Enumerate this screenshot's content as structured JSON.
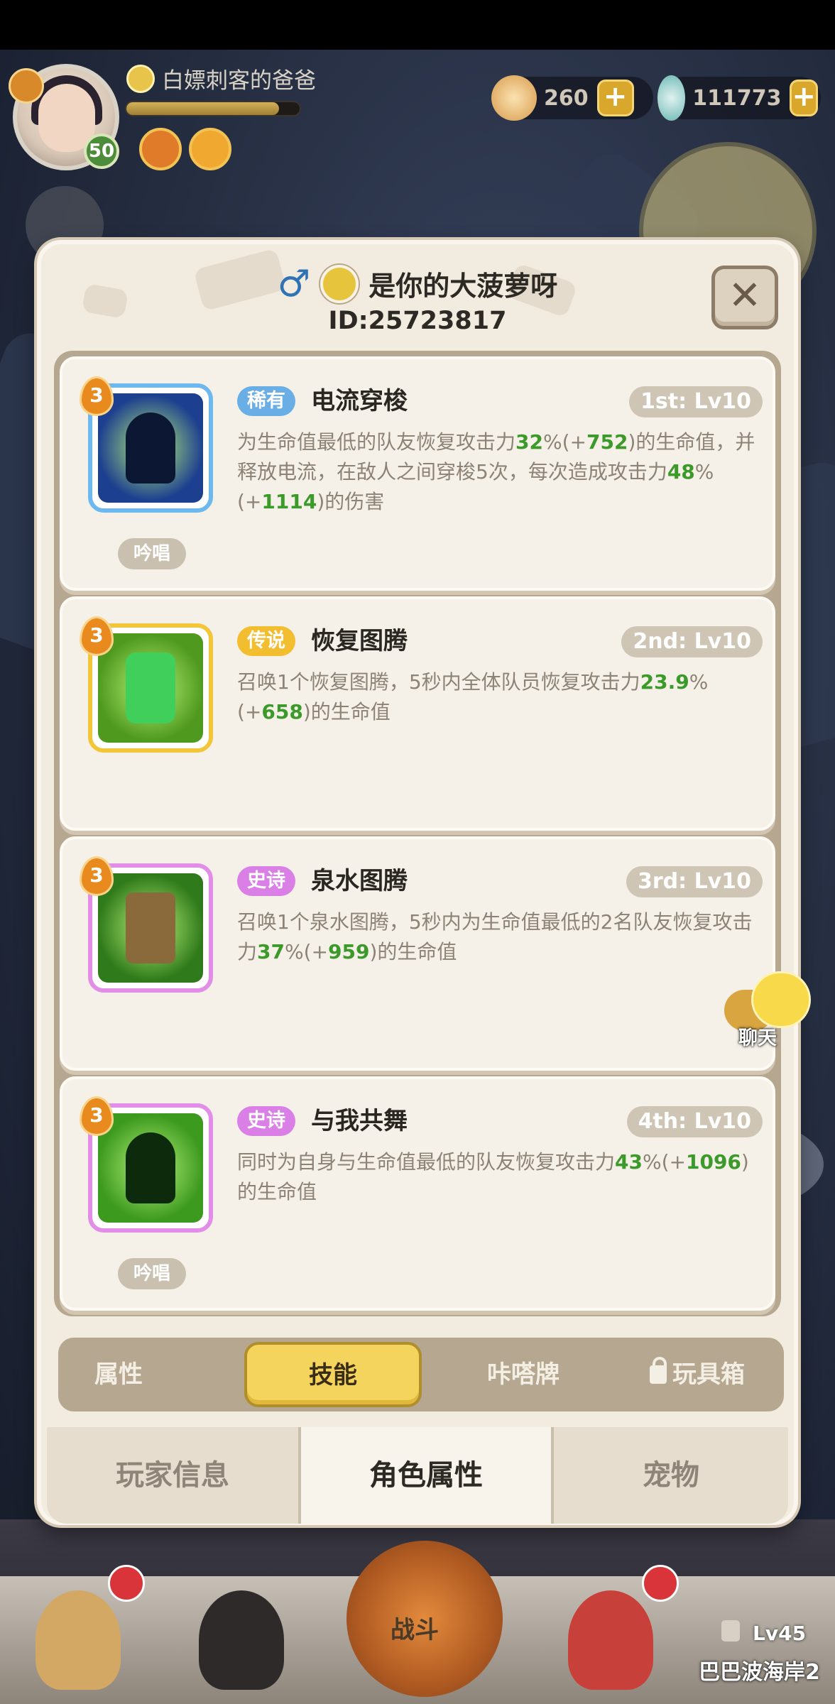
{
  "hud": {
    "player_name": "白嫖刺客的爸爸",
    "level": "50",
    "xp_fraction": 0.88,
    "currencies": [
      {
        "icon": "shell-star-icon",
        "value": "260"
      },
      {
        "icon": "pearl-icon",
        "value": "111773"
      }
    ],
    "plus_label": "+"
  },
  "modal": {
    "gender_icon": "♂",
    "player_name": "是你的大菠萝呀",
    "player_id": "ID:25723817",
    "close_label": "✕",
    "skills": [
      {
        "level_badge": "3",
        "rarity": "稀有",
        "rarity_color": "#6aaee6",
        "name": "电流穿梭",
        "slot": "1st: Lv10",
        "desc_parts": [
          "为生命值最低的队友恢复攻击力",
          "32",
          "%(+",
          "752",
          ")的生命值，并释放电流，在敌人之间穿梭5次，每次造成攻击力",
          "48",
          "%(+",
          "1114",
          ")的伤害"
        ],
        "chant": "吟唱",
        "icon_border": "#6cb8ef",
        "icon_bg": "#1c3f8f"
      },
      {
        "level_badge": "3",
        "rarity": "传说",
        "rarity_color": "#f2bd2e",
        "name": "恢复图腾",
        "slot": "2nd: Lv10",
        "desc_parts": [
          "召唤1个恢复图腾，5秒内全体队员恢复攻击力",
          "23.9",
          "%(+",
          "658",
          ")的生命值"
        ],
        "chant": "",
        "icon_border": "#f3c63a",
        "icon_bg": "#4f9a1e"
      },
      {
        "level_badge": "3",
        "rarity": "史诗",
        "rarity_color": "#d97fe6",
        "name": "泉水图腾",
        "slot": "3rd: Lv10",
        "desc_parts": [
          "召唤1个泉水图腾，5秒内为生命值最低的2名队友恢复攻击力",
          "37",
          "%(+",
          "959",
          ")的生命值"
        ],
        "chant": "",
        "icon_border": "#e28ee8",
        "icon_bg": "#2f7a1a"
      },
      {
        "level_badge": "3",
        "rarity": "史诗",
        "rarity_color": "#d97fe6",
        "name": "与我共舞",
        "slot": "4th: Lv10",
        "desc_parts": [
          "同时为自身与生命值最低的队友恢复攻击力",
          "43",
          "%(+",
          "1096",
          ")的生命值"
        ],
        "chant": "吟唱",
        "icon_border": "#e28ee8",
        "icon_bg": "#3c9a1e"
      }
    ],
    "subtabs": [
      "属性",
      "技能",
      "咔嗒牌",
      "玩具箱"
    ],
    "active_subtab": "技能",
    "maintabs": [
      "玩家信息",
      "角色属性",
      "宠物"
    ],
    "active_maintab": "角色属性"
  },
  "chat": {
    "label": "聊天"
  },
  "bottom_nav": {
    "battle_label": "战斗",
    "location_level": "Lv45",
    "location_name": "巴巴波海岸2"
  }
}
